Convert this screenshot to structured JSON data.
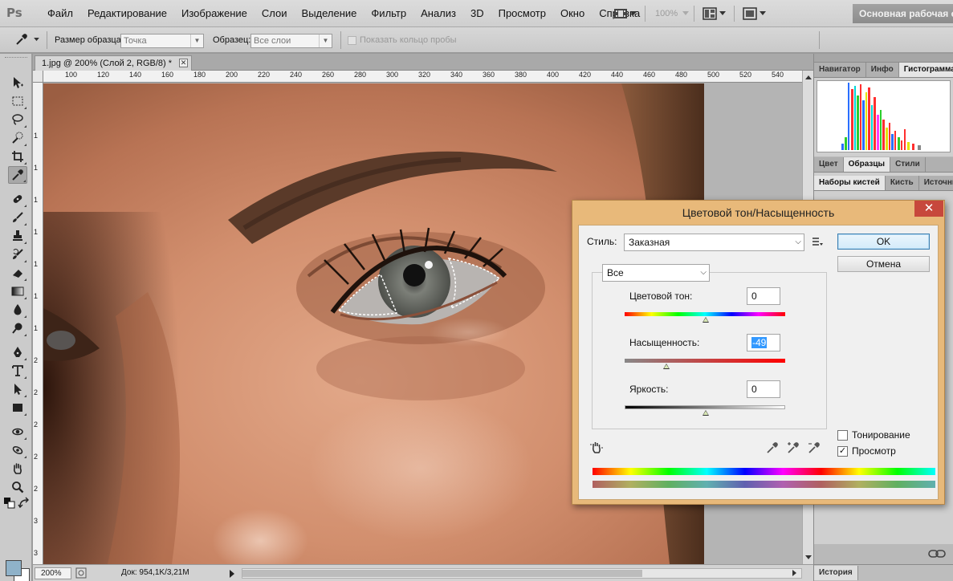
{
  "app": {
    "logo": "Ps",
    "menu": [
      "Файл",
      "Редактирование",
      "Изображение",
      "Слои",
      "Выделение",
      "Фильтр",
      "Анализ",
      "3D",
      "Просмотр",
      "Окно",
      "Справка"
    ],
    "zoom_readout": "100%",
    "workspace_button": "Основная рабочая с"
  },
  "options": {
    "sample_size_label": "Размер образца:",
    "sample_size_value": "Точка",
    "sample_label": "Образец:",
    "sample_value": "Все слои",
    "show_ring_label": "Показать кольцо пробы"
  },
  "document": {
    "tab_title": "1.jpg @ 200% (Слой 2, RGB/8) *",
    "ruler_h": [
      "100",
      "120",
      "140",
      "160",
      "180",
      "200",
      "220",
      "240",
      "260",
      "280",
      "300",
      "320",
      "340",
      "360",
      "380",
      "400",
      "420",
      "440",
      "460",
      "480",
      "500",
      "520",
      "540"
    ],
    "ruler_v": [
      "1",
      "1",
      "1",
      "1",
      "1",
      "1",
      "1",
      "2",
      "2",
      "2",
      "2",
      "2",
      "3",
      "3",
      "3"
    ],
    "status_zoom": "200%",
    "status_doc": "Док: 954,1K/3,21M"
  },
  "panels": {
    "top_tabs": [
      "Навигатор",
      "Инфо",
      "Гистограмма"
    ],
    "color_tabs": [
      "Цвет",
      "Образцы",
      "Стили"
    ],
    "brush_tabs": [
      "Наборы кистей",
      "Кисть",
      "Источник"
    ],
    "history_tab": "История"
  },
  "dialog": {
    "title": "Цветовой тон/Насыщенность",
    "style_label": "Стиль:",
    "style_value": "Заказная",
    "ok_label": "OK",
    "cancel_label": "Отмена",
    "channel_value": "Все",
    "hue_label": "Цветовой тон:",
    "hue_value": "0",
    "saturation_label": "Насыщенность:",
    "saturation_value": "-49",
    "lightness_label": "Яркость:",
    "lightness_value": "0",
    "colorize_label": "Тонирование",
    "colorize_checked": false,
    "preview_label": "Просмотр",
    "preview_checked": true
  },
  "colors": {
    "foreground": "#8fb2c9",
    "background": "#ffffff",
    "dialog_frame": "#e8b97a",
    "close_button": "#c7483c"
  },
  "tools": [
    "move-icon",
    "marquee-icon",
    "lasso-icon",
    "quick-select-icon",
    "crop-icon",
    "eyedropper-icon",
    "healing-brush-icon",
    "brush-icon",
    "clone-stamp-icon",
    "history-brush-icon",
    "eraser-icon",
    "gradient-icon",
    "blur-icon",
    "dodge-icon",
    "pen-icon",
    "type-icon",
    "path-select-icon",
    "shape-icon",
    "3d-rotate-icon",
    "3d-orbit-icon",
    "hand-icon",
    "zoom-icon"
  ]
}
